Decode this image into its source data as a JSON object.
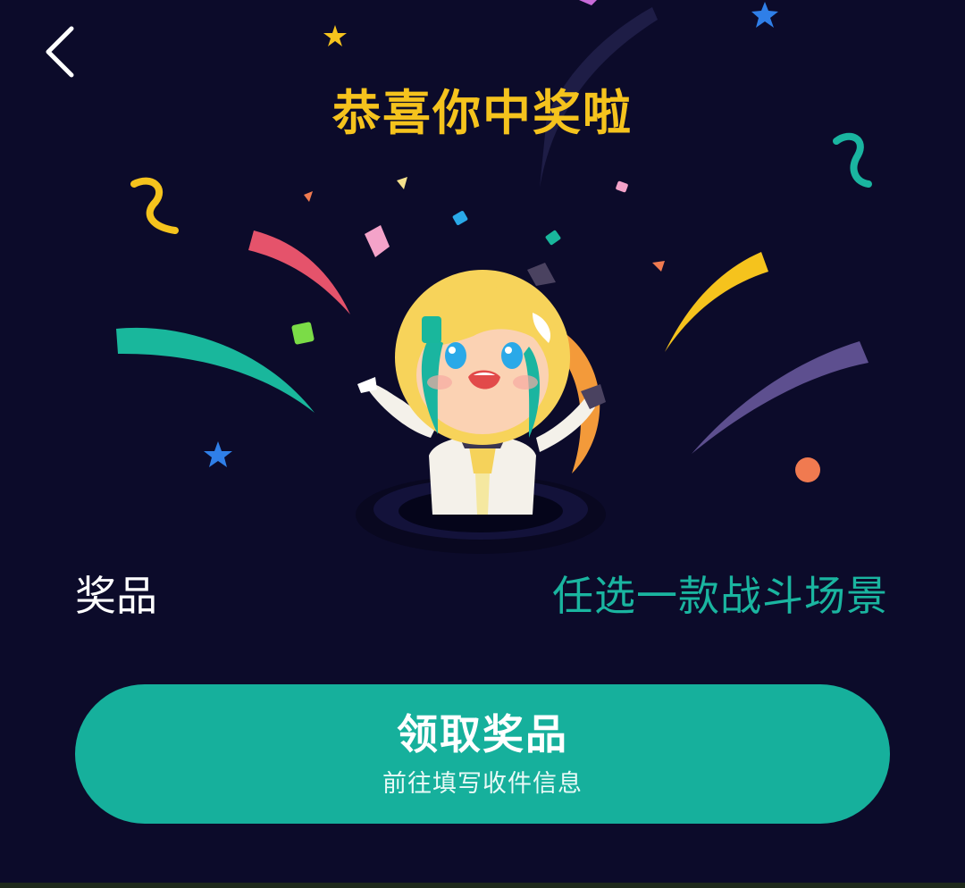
{
  "header": {
    "back_icon": "chevron-left-icon",
    "title": "恭喜你中奖啦"
  },
  "prize": {
    "label": "奖品",
    "value": "任选一款战斗场景"
  },
  "claim_button": {
    "title": "领取奖品",
    "subtitle": "前往填写收件信息"
  },
  "colors": {
    "background": "#0c0b2a",
    "title": "#f5c31d",
    "accent": "#16b09c",
    "prize_value": "#1ab5a0"
  }
}
